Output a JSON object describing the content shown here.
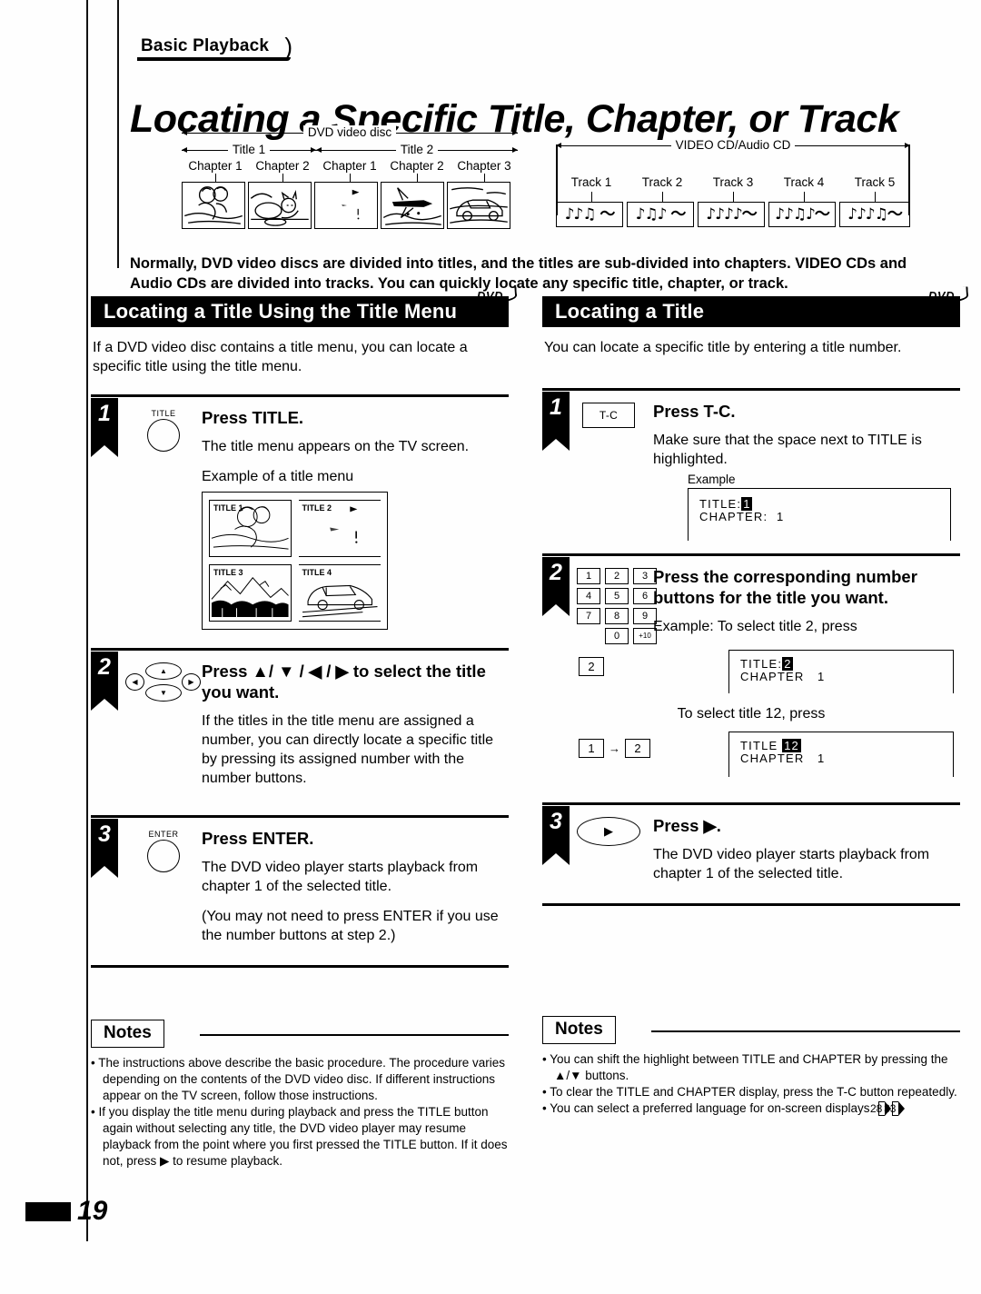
{
  "breadcrumb": "Basic Playback",
  "page_title": "Locating a Specific Title, Chapter, or Track",
  "page_number": "19",
  "diagrams": {
    "dvd": {
      "span_label": "DVD video disc",
      "titles": [
        "Title 1",
        "Title 2"
      ],
      "chapters": [
        "Chapter 1",
        "Chapter 2",
        "Chapter 1",
        "Chapter 2",
        "Chapter 3"
      ],
      "thumbnails": [
        "people-scene",
        "cat-scene",
        "blank-scene",
        "airplane-scene",
        "car-scene"
      ]
    },
    "cd": {
      "span_label": "VIDEO CD/Audio CD",
      "tracks": [
        "Track 1",
        "Track 2",
        "Track 3",
        "Track 4",
        "Track 5"
      ],
      "track_glyphs": [
        "♪♪♫  〜",
        "♪♫♪ 〜",
        "♪♪♪♪〜",
        "♪♪♫♪〜",
        "♪♪♪♫〜"
      ]
    }
  },
  "intro": "Normally, DVD video discs are divided into titles, and the titles are sub-divided into chapters. VIDEO CDs and Audio CDs are divided into tracks. You can quickly locate any specific title, chapter, or track.",
  "left_column": {
    "section_title": "Locating a Title Using the Title Menu",
    "disc_badge": "DVD",
    "lead": "If a DVD video disc contains a title menu, you can locate a specific title using the title menu.",
    "steps": [
      {
        "number": "1",
        "icon_caption": "TITLE",
        "title": "Press TITLE.",
        "paragraphs": [
          "The title menu appears on the TV screen.",
          "Example of a title menu"
        ]
      },
      {
        "number": "2",
        "title": "Press ▲/ ▼ / ◀ / ▶  to select the title you want.",
        "paragraphs": [
          "If the titles in the title menu are assigned a number, you can directly locate a specific title by pressing its assigned number with the number buttons."
        ]
      },
      {
        "number": "3",
        "icon_caption": "ENTER",
        "title": "Press ENTER.",
        "paragraphs": [
          "The DVD video player starts playback from chapter 1 of the selected title.",
          "(You may not need to press ENTER if you use the number buttons at step 2.)"
        ]
      }
    ],
    "title_menu_example": {
      "cells": [
        "TITLE 1",
        "TITLE 2",
        "TITLE 3",
        "TITLE 4"
      ]
    },
    "notes_heading": "Notes",
    "notes": [
      "The instructions above describe the basic procedure. The procedure varies depending on the contents of the DVD video disc. If different instructions appear on the TV screen, follow those instructions.",
      "If you display the title menu during playback and press the TITLE button again without selecting any title, the DVD video player may resume playback from the point where you first pressed the TITLE button. If it does not, press ▶ to resume playback."
    ]
  },
  "right_column": {
    "section_title": "Locating a Title",
    "disc_badge": "DVD",
    "lead": "You can locate a specific title by entering a title number.",
    "steps": [
      {
        "number": "1",
        "icon_label": "T-C",
        "title": "Press T-C.",
        "paragraphs": [
          "Make sure that the space next to TITLE is highlighted."
        ],
        "example_label": "Example",
        "osd": {
          "title_label": "TITLE:",
          "title_value": "1",
          "chapter_label": "CHAPTER:",
          "chapter_value": "1"
        }
      },
      {
        "number": "2",
        "keypad": [
          "1",
          "2",
          "3",
          "4",
          "5",
          "6",
          "7",
          "8",
          "9",
          "0",
          "+10"
        ],
        "title": "Press the corresponding number buttons for the title you want.",
        "paragraphs": [
          "Example: To select title 2, press"
        ],
        "example_a": {
          "keys": [
            "2"
          ],
          "osd": {
            "title_label": "TITLE:",
            "title_value": "2",
            "chapter_label": "CHAPTER",
            "chapter_value": "1"
          }
        },
        "mid_note": "To select title 12, press",
        "example_b": {
          "keys": [
            "1",
            "2"
          ],
          "key_arrow": "→",
          "osd": {
            "title_label": "TITLE",
            "title_value": "12",
            "chapter_label": "CHAPTER",
            "chapter_value": "1"
          }
        }
      },
      {
        "number": "3",
        "icon_glyph": "▶",
        "title": "Press ▶.",
        "paragraphs": [
          "The DVD video player starts playback from chapter 1 of the selected title."
        ]
      }
    ],
    "notes_heading": "Notes",
    "notes": [
      "You can shift the highlight between TITLE and CHAPTER by pressing the ▲/▼ buttons.",
      "To clear the TITLE and CHAPTER display, press the T-C button repeatedly.",
      "You can select a preferred language for on-screen displays."
    ],
    "note_page_refs": [
      "28",
      "33"
    ]
  }
}
